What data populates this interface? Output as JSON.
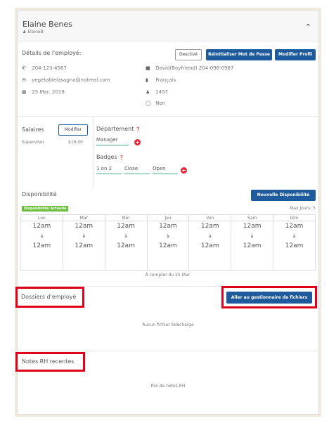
{
  "header": {
    "name": "Elaine Benes",
    "username": "ElaineB"
  },
  "details": {
    "title": "Détails de l'employé:",
    "buttons": {
      "deactivate": "Desctivé",
      "reset": "Réinitialiser Mot de Passe",
      "edit": "Modifier Profil"
    },
    "phone": "204-123-4567",
    "email": "vegetablelasagna@notreal.com",
    "date": "25 Mar, 2019",
    "emergency": "David(Boyfriend) 204-098-0987",
    "language": "Français",
    "employee_id": "1457",
    "status": "Non"
  },
  "salary": {
    "title": "Salaires",
    "edit": "Modifier",
    "role": "Supervisor",
    "rate": "$19.00",
    "department_label": "Département",
    "department_value": "Manager",
    "badges_label": "Badges",
    "badges": [
      "1 on 2",
      "Close",
      "Open"
    ]
  },
  "availability": {
    "title": "Disponibilité",
    "new_button": "Nouvelle Disponibilité",
    "current_tag": "Disponibilité Actuelle",
    "max_days": "Max Jours: 5",
    "days": [
      "Lun",
      "Mar",
      "Mer",
      "Jeu",
      "Ven",
      "Sam",
      "Dim"
    ],
    "start": "12am",
    "to": "à",
    "end": "12am",
    "from": "À compter du 25 Mar."
  },
  "files": {
    "title": "Dossiers d'employé",
    "manager_button": "Aller au gestionnaire de fichiers",
    "empty": "Aucun fichier telecharge"
  },
  "notes": {
    "title": "Notes RH recentes",
    "empty": "Pas de notes RH"
  },
  "colors": {
    "primary": "#1e5a9c",
    "success": "#6bbf3a",
    "danger": "#e0001a"
  }
}
